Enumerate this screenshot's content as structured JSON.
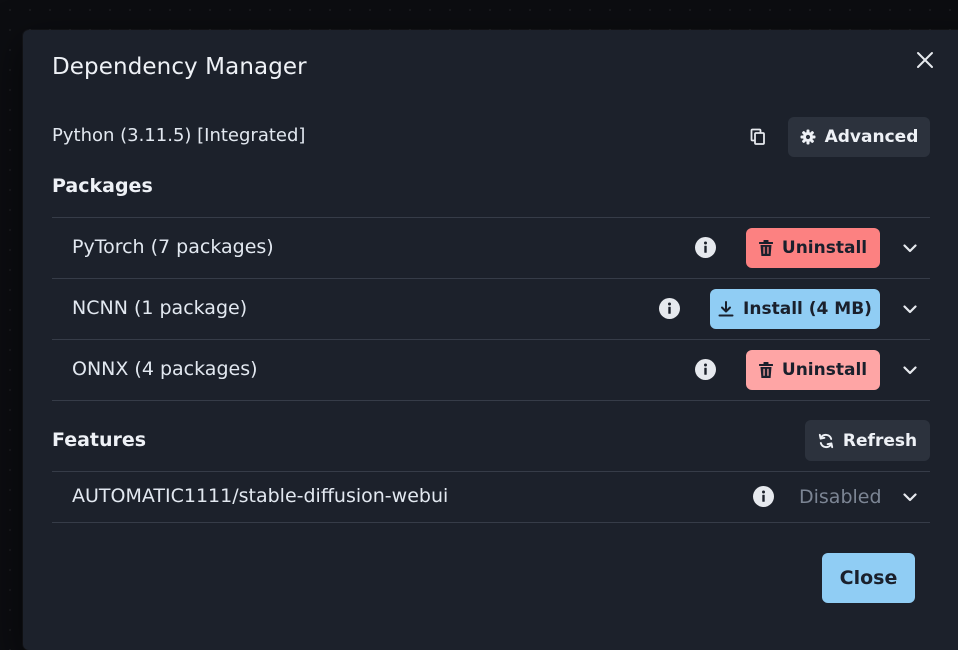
{
  "dialog": {
    "title": "Dependency Manager",
    "python_label": "Python (3.11.5) [Integrated]",
    "advanced_label": "Advanced",
    "packages_heading": "Packages",
    "features_heading": "Features",
    "refresh_label": "Refresh",
    "close_label": "Close"
  },
  "packages": [
    {
      "name": "PyTorch (7 packages)",
      "action": "Uninstall",
      "action_color": "#fc8181"
    },
    {
      "name": "NCNN (1 package)",
      "action": "Install (4 MB)",
      "action_color": "#90cdf4"
    },
    {
      "name": "ONNX (4 packages)",
      "action": "Uninstall",
      "action_color": "#fea5a5"
    }
  ],
  "features": [
    {
      "name": "AUTOMATIC1111/stable-diffusion-webui",
      "status": "Disabled"
    }
  ],
  "icons": {
    "close": "close-icon",
    "copy": "copy-icon",
    "settings": "gear-icon",
    "info": "info-icon",
    "trash": "trash-icon",
    "download": "download-icon",
    "refresh": "refresh-icon",
    "expand": "chevron-down-icon"
  }
}
